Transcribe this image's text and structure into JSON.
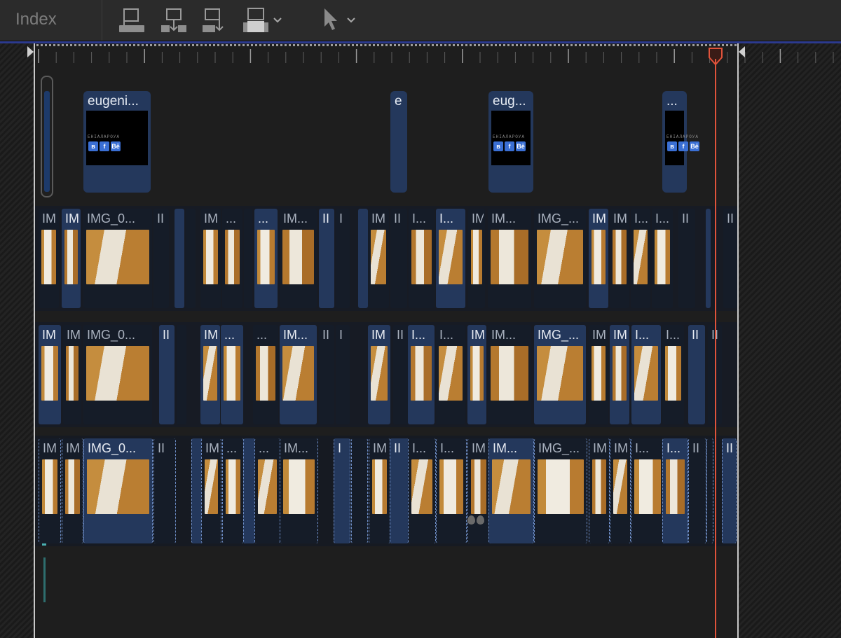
{
  "toolbar": {
    "index_label": "Index",
    "buttons": [
      {
        "name": "connect-clip-button",
        "icon": "connect-clip-icon"
      },
      {
        "name": "insert-clip-button",
        "icon": "insert-clip-icon"
      },
      {
        "name": "append-clip-button",
        "icon": "append-clip-icon"
      },
      {
        "name": "overwrite-clip-button",
        "icon": "overwrite-clip-icon",
        "has_menu": true
      },
      {
        "name": "select-tool-button",
        "icon": "arrow-pointer-icon",
        "has_menu": true
      }
    ]
  },
  "colors": {
    "toolbar_bg": "#2b2b2b",
    "timeline_bg": "#1e1e1e",
    "clip_bg": "#151c28",
    "clip_selected_bg": "#24385c",
    "playhead": "#e0533b",
    "accent_line": "#2c3a8e"
  },
  "title_clips": [
    {
      "label": "eugeni...",
      "has_thumb": true
    },
    {
      "label": "e",
      "has_thumb": false
    },
    {
      "label": "eug...",
      "has_thumb": true
    },
    {
      "label": "...",
      "has_thumb": true
    }
  ],
  "title_thumb": {
    "watermark": "ЕНІАЛАРОУА"
  },
  "lanes": [
    {
      "name": "lane-1",
      "clips": [
        {
          "label": "IM",
          "sel": false,
          "thumb": true
        },
        {
          "label": "IM",
          "sel": true,
          "thumb": true
        },
        {
          "label": "IMG_0...",
          "sel": false,
          "thumb": true
        },
        {
          "label": "II",
          "sel": false,
          "thumb": false
        },
        {
          "label": "",
          "sel": true,
          "thumb": false
        },
        {
          "label": "",
          "sel": false,
          "thumb": false
        },
        {
          "label": "IM",
          "sel": false,
          "thumb": true
        },
        {
          "label": "...",
          "sel": false,
          "thumb": true
        },
        {
          "label": "",
          "sel": false,
          "thumb": false
        },
        {
          "label": "...",
          "sel": true,
          "thumb": true
        },
        {
          "label": "IM...",
          "sel": false,
          "thumb": true
        },
        {
          "label": "II",
          "sel": true,
          "thumb": false
        },
        {
          "label": "I",
          "sel": false,
          "thumb": false
        },
        {
          "label": "",
          "sel": true,
          "thumb": false
        },
        {
          "label": "IM",
          "sel": false,
          "thumb": true
        },
        {
          "label": "II",
          "sel": false,
          "thumb": false
        },
        {
          "label": "I...",
          "sel": false,
          "thumb": true
        },
        {
          "label": "I...",
          "sel": true,
          "thumb": true
        },
        {
          "label": "IM",
          "sel": false,
          "thumb": true
        },
        {
          "label": "IM...",
          "sel": false,
          "thumb": true
        },
        {
          "label": "IMG_...",
          "sel": false,
          "thumb": true
        },
        {
          "label": "IM",
          "sel": true,
          "thumb": true
        },
        {
          "label": "IM",
          "sel": false,
          "thumb": true
        },
        {
          "label": "I...",
          "sel": false,
          "thumb": true
        },
        {
          "label": "I...",
          "sel": false,
          "thumb": true
        },
        {
          "label": "II",
          "sel": false,
          "thumb": false
        },
        {
          "label": "",
          "sel": true,
          "thumb": false
        },
        {
          "label": "II",
          "sel": false,
          "thumb": false
        }
      ]
    },
    {
      "name": "lane-2",
      "clips": [
        {
          "label": "IM",
          "sel": true,
          "thumb": true
        },
        {
          "label": "IM",
          "sel": false,
          "thumb": true
        },
        {
          "label": "IMG_0...",
          "sel": false,
          "thumb": true
        },
        {
          "label": "II",
          "sel": true,
          "thumb": false
        },
        {
          "label": "",
          "sel": false,
          "thumb": false
        },
        {
          "label": "IM",
          "sel": true,
          "thumb": true
        },
        {
          "label": "...",
          "sel": true,
          "thumb": true
        },
        {
          "label": "...",
          "sel": false,
          "thumb": true
        },
        {
          "label": "IM...",
          "sel": true,
          "thumb": true
        },
        {
          "label": "II",
          "sel": false,
          "thumb": false
        },
        {
          "label": "I",
          "sel": false,
          "thumb": false
        },
        {
          "label": "IM",
          "sel": true,
          "thumb": true
        },
        {
          "label": "II",
          "sel": false,
          "thumb": false
        },
        {
          "label": "I...",
          "sel": true,
          "thumb": true
        },
        {
          "label": "I...",
          "sel": false,
          "thumb": true
        },
        {
          "label": "IM",
          "sel": true,
          "thumb": true
        },
        {
          "label": "IM...",
          "sel": false,
          "thumb": true
        },
        {
          "label": "IMG_...",
          "sel": true,
          "thumb": true
        },
        {
          "label": "IM",
          "sel": false,
          "thumb": true
        },
        {
          "label": "IM",
          "sel": true,
          "thumb": true
        },
        {
          "label": "I...",
          "sel": true,
          "thumb": true
        },
        {
          "label": "I...",
          "sel": false,
          "thumb": true
        },
        {
          "label": "II",
          "sel": true,
          "thumb": false
        },
        {
          "label": "II",
          "sel": false,
          "thumb": false
        }
      ]
    },
    {
      "name": "lane-3",
      "clips": [
        {
          "label": "IM",
          "sel": false,
          "thumb": true
        },
        {
          "label": "IM",
          "sel": false,
          "thumb": true
        },
        {
          "label": "IMG_0...",
          "sel": true,
          "thumb": true
        },
        {
          "label": "II",
          "sel": false,
          "thumb": false
        },
        {
          "label": "",
          "sel": true,
          "thumb": false
        },
        {
          "label": "IM",
          "sel": false,
          "thumb": true
        },
        {
          "label": "...",
          "sel": false,
          "thumb": true
        },
        {
          "label": "",
          "sel": true,
          "thumb": false
        },
        {
          "label": "...",
          "sel": false,
          "thumb": true
        },
        {
          "label": "IM...",
          "sel": false,
          "thumb": true
        },
        {
          "label": "I",
          "sel": true,
          "thumb": false
        },
        {
          "label": "",
          "sel": false,
          "thumb": false
        },
        {
          "label": "IM",
          "sel": false,
          "thumb": true
        },
        {
          "label": "II",
          "sel": true,
          "thumb": false
        },
        {
          "label": "I...",
          "sel": false,
          "thumb": true
        },
        {
          "label": "I...",
          "sel": false,
          "thumb": true
        },
        {
          "label": "IM",
          "sel": false,
          "thumb": true
        },
        {
          "label": "IM...",
          "sel": true,
          "thumb": true
        },
        {
          "label": "IMG_...",
          "sel": false,
          "thumb": true
        },
        {
          "label": "IM",
          "sel": false,
          "thumb": true
        },
        {
          "label": "IM",
          "sel": false,
          "thumb": true
        },
        {
          "label": "I...",
          "sel": false,
          "thumb": true
        },
        {
          "label": "I...",
          "sel": true,
          "thumb": true
        },
        {
          "label": "II",
          "sel": false,
          "thumb": false
        },
        {
          "label": "",
          "sel": false,
          "thumb": false
        },
        {
          "label": "II",
          "sel": true,
          "thumb": false
        }
      ]
    }
  ]
}
